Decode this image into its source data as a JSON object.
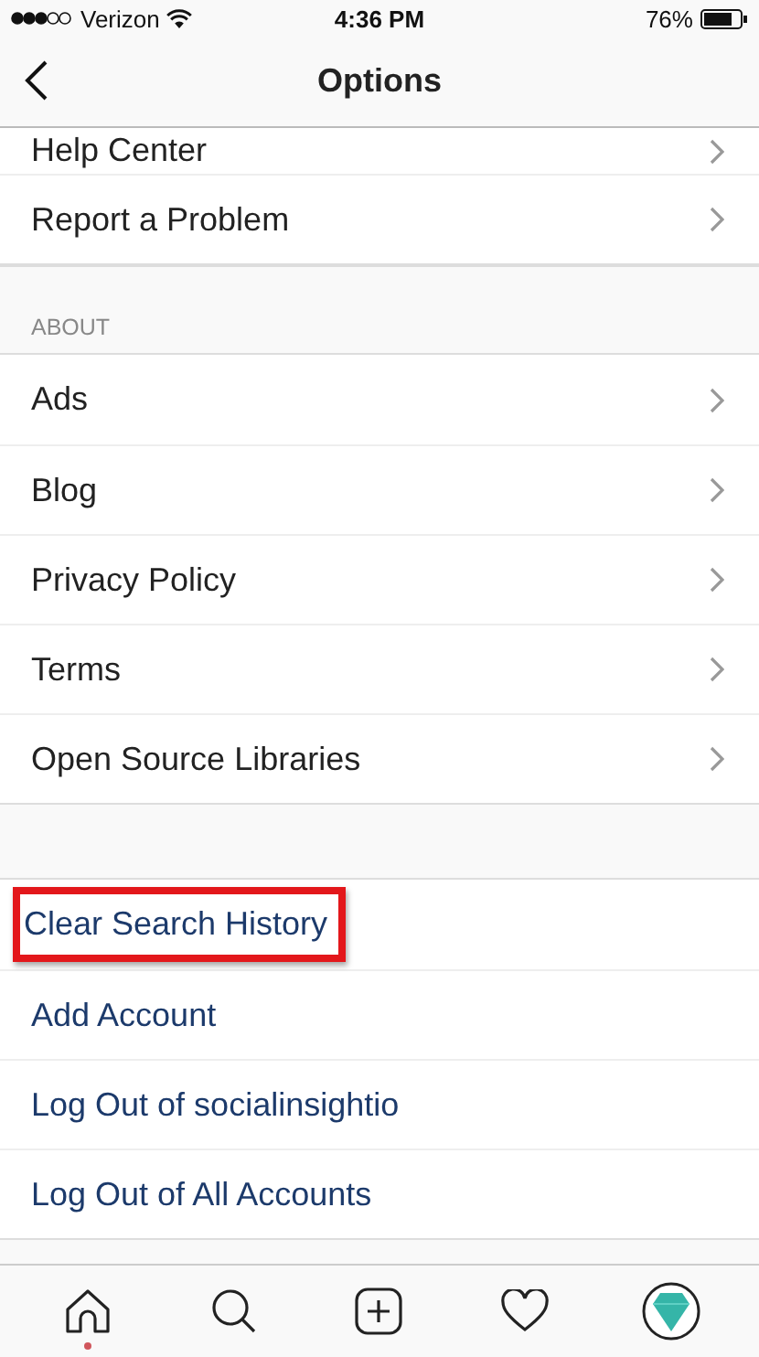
{
  "status_bar": {
    "carrier": "Verizon",
    "time": "4:36 PM",
    "battery": "76%"
  },
  "nav": {
    "title": "Options"
  },
  "sections": [
    {
      "items": [
        {
          "label": "Help Center",
          "kind": "nav"
        },
        {
          "label": "Report a Problem",
          "kind": "nav"
        }
      ]
    },
    {
      "header": "ABOUT",
      "items": [
        {
          "label": "Ads",
          "kind": "nav"
        },
        {
          "label": "Blog",
          "kind": "nav"
        },
        {
          "label": "Privacy Policy",
          "kind": "nav"
        },
        {
          "label": "Terms",
          "kind": "nav"
        },
        {
          "label": "Open Source Libraries",
          "kind": "nav"
        }
      ]
    },
    {
      "items": [
        {
          "label": "Clear Search History",
          "kind": "action",
          "highlighted": true
        },
        {
          "label": "Add Account",
          "kind": "action",
          "highlighted": false
        },
        {
          "label": "Log Out of socialinsightio",
          "kind": "action",
          "highlighted": false
        },
        {
          "label": "Log Out of All Accounts",
          "kind": "action",
          "highlighted": false
        }
      ]
    }
  ],
  "tab_bar": {
    "items": [
      {
        "kind": "home",
        "badge": true
      },
      {
        "kind": "search",
        "badge": false
      },
      {
        "kind": "add",
        "badge": false
      },
      {
        "kind": "heart",
        "badge": false
      },
      {
        "kind": "profile",
        "badge": false
      }
    ]
  }
}
